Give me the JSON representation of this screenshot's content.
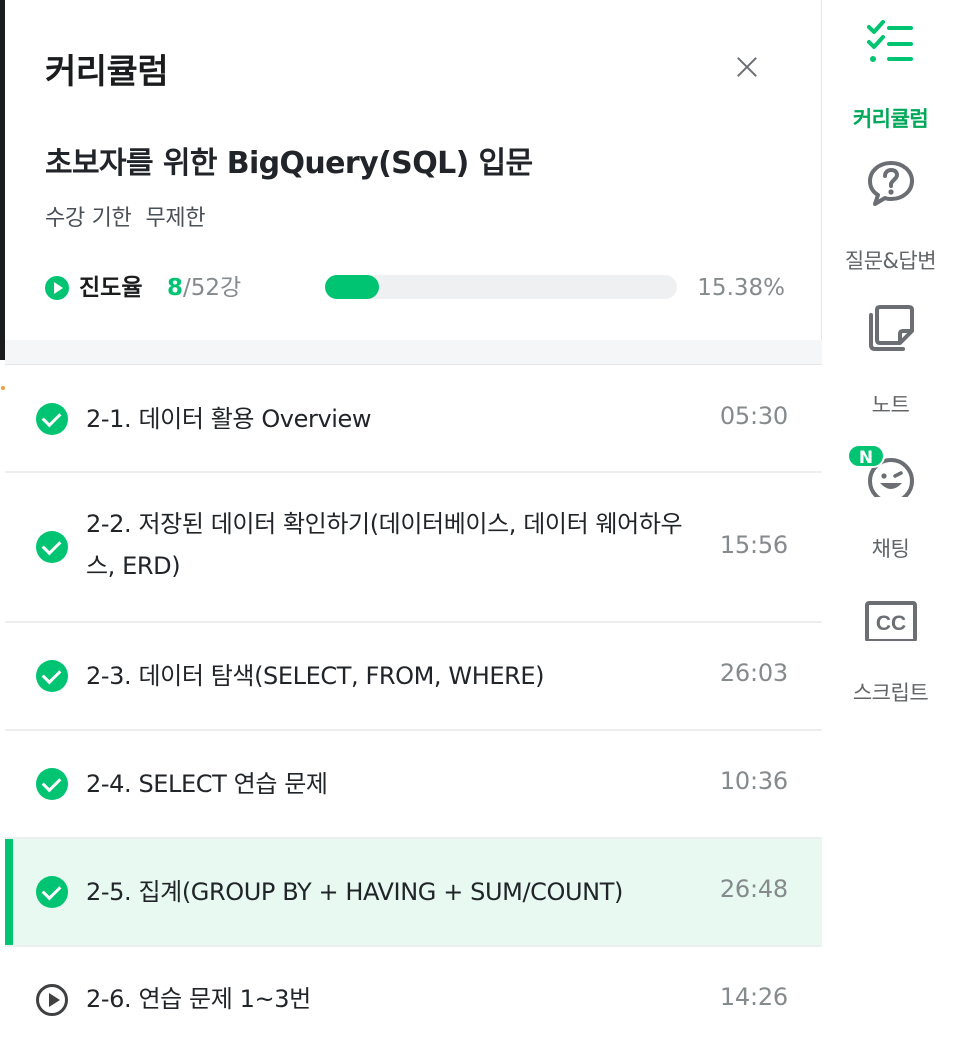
{
  "panel": {
    "title": "커리큘럼"
  },
  "course": {
    "title": "초보자를 위한 BigQuery(SQL) 입문",
    "period_label": "수강 기한",
    "period_value": "무제한"
  },
  "progress": {
    "label": "진도율",
    "completed": "8",
    "total": "/52강",
    "percent_text": "15.38%",
    "fraction": 0.1538
  },
  "lessons": [
    {
      "title": "2-1. 데이터 활용 Overview",
      "time": "05:30",
      "status": "completed",
      "active": false
    },
    {
      "title": "2-2. 저장된 데이터 확인하기(데이터베이스, 데이터 웨어하우스, ERD)",
      "time": "15:56",
      "status": "completed",
      "active": false
    },
    {
      "title": "2-3. 데이터 탐색(SELECT, FROM, WHERE)",
      "time": "26:03",
      "status": "completed",
      "active": false
    },
    {
      "title": "2-4. SELECT 연습 문제",
      "time": "10:36",
      "status": "completed",
      "active": false
    },
    {
      "title": "2-5. 집계(GROUP BY + HAVING + SUM/COUNT)",
      "time": "26:48",
      "status": "completed",
      "active": true
    },
    {
      "title": "2-6. 연습 문제 1~3번",
      "time": "14:26",
      "status": "play",
      "active": false
    }
  ],
  "rail": {
    "items": [
      {
        "label": "커리큘럼",
        "icon": "curriculum-list-icon",
        "active": true
      },
      {
        "label": "질문&답변",
        "icon": "question-bubble-icon",
        "active": false
      },
      {
        "label": "노트",
        "icon": "note-icon",
        "active": false
      },
      {
        "label": "채팅",
        "icon": "chat-smile-icon",
        "active": false
      },
      {
        "label": "스크립트",
        "icon": "cc-icon",
        "active": false
      }
    ],
    "chat_badge": "N"
  },
  "colors": {
    "accent": "#00c471",
    "active_row_bg": "#e7f9f0",
    "muted_text": "#858a8d"
  }
}
